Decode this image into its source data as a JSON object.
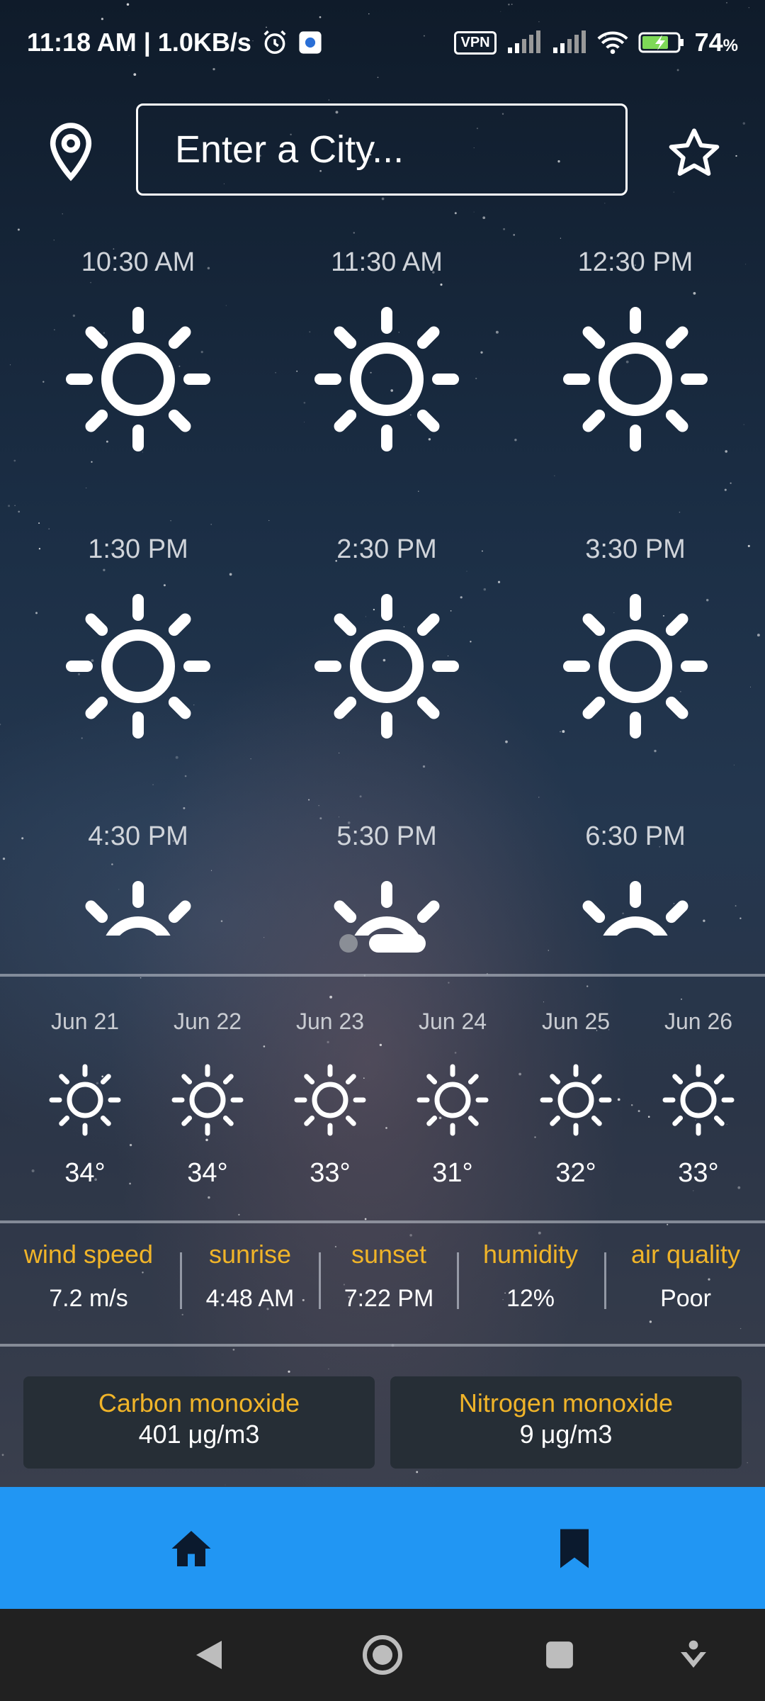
{
  "status_bar": {
    "time": "11:18 AM | 1.0KB/s",
    "vpn": "VPN",
    "battery": "74",
    "battery_unit": "%"
  },
  "search": {
    "placeholder": "Enter a City...",
    "location_icon": "location-pin-icon",
    "favorite_icon": "star-outline-icon"
  },
  "hourly": [
    {
      "time": "10:30 AM",
      "icon": "sun-icon"
    },
    {
      "time": "11:30 AM",
      "icon": "sun-icon"
    },
    {
      "time": "12:30 PM",
      "icon": "sun-icon"
    },
    {
      "time": "1:30 PM",
      "icon": "sun-icon"
    },
    {
      "time": "2:30 PM",
      "icon": "sun-icon"
    },
    {
      "time": "3:30 PM",
      "icon": "sun-icon"
    },
    {
      "time": "4:30 PM",
      "icon": "sun-icon"
    },
    {
      "time": "5:30 PM",
      "icon": "sun-icon"
    },
    {
      "time": "6:30 PM",
      "icon": "sun-icon"
    }
  ],
  "pager": {
    "pages": 2,
    "active": 2
  },
  "daily": [
    {
      "date": "Jun 21",
      "temp": "34°",
      "icon": "sun-icon"
    },
    {
      "date": "Jun 22",
      "temp": "34°",
      "icon": "sun-icon"
    },
    {
      "date": "Jun 23",
      "temp": "33°",
      "icon": "sun-icon"
    },
    {
      "date": "Jun 24",
      "temp": "31°",
      "icon": "sun-icon"
    },
    {
      "date": "Jun 25",
      "temp": "32°",
      "icon": "sun-icon"
    },
    {
      "date": "Jun 26",
      "temp": "33°",
      "icon": "sun-icon"
    }
  ],
  "stats": [
    {
      "label": "wind speed",
      "value": "7.2 m/s"
    },
    {
      "label": "sunrise",
      "value": "4:48 AM"
    },
    {
      "label": "sunset",
      "value": "7:22 PM"
    },
    {
      "label": "humidity",
      "value": "12%"
    },
    {
      "label": "air quality",
      "value": "Poor"
    }
  ],
  "gases": [
    {
      "label": "Carbon monoxide",
      "value": "401 μg/m3"
    },
    {
      "label": "Nitrogen monoxide",
      "value": "9 μg/m3"
    }
  ],
  "bottom_nav": [
    {
      "name": "home",
      "icon": "home-icon"
    },
    {
      "name": "saved",
      "icon": "bookmark-icon"
    }
  ],
  "colors": {
    "accent_label": "#f0b429",
    "nav_bar": "#2196f3",
    "card_bg": "#262e36"
  }
}
